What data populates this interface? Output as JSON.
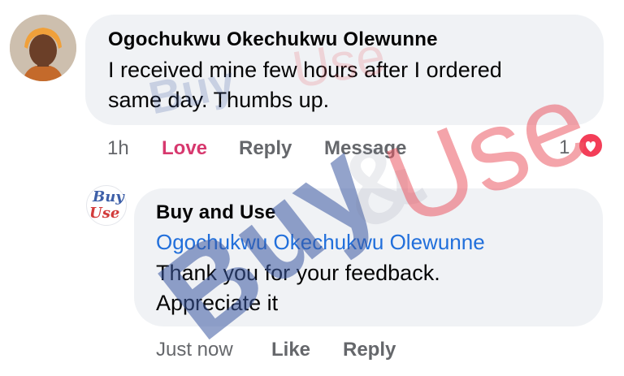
{
  "comment": {
    "author": "Ogochukwu Okechukwu Olewunne",
    "text_line1": "I received mine few hours after I ordered",
    "text_line2": "same day. Thumbs up.",
    "time": "1h",
    "love_label": "Love",
    "reply_label": "Reply",
    "message_label": "Message",
    "reaction_count": "1",
    "reaction_icon": "heart-icon"
  },
  "reply": {
    "author": "Buy and Use",
    "logo_line1": "Buy",
    "logo_line2": "Use",
    "mention": "Ogochukwu Okechukwu Olewunne",
    "text_line1": "Thank you for your feedback.",
    "text_line2": "Appreciate it",
    "time": "Just now",
    "like_label": "Like",
    "reply_label": "Reply"
  },
  "watermark": {
    "word1": "Buy",
    "amp": "&",
    "word2": "Use"
  },
  "colors": {
    "bubble": "#f0f2f5",
    "love": "#d7386e",
    "mention": "#216fdb",
    "muted": "#65676b",
    "heart": "#f33e58"
  }
}
